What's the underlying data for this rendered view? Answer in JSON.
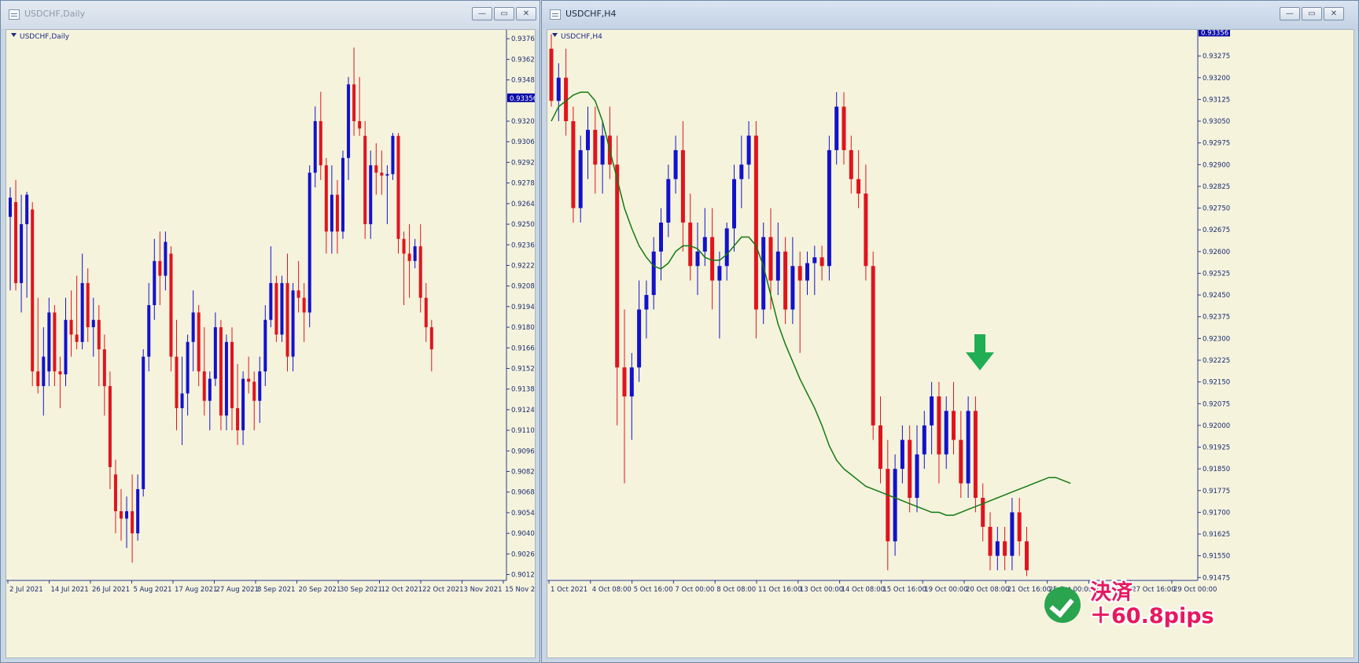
{
  "windows": {
    "left": {
      "title": "USDCHF,Daily",
      "chart_label": "USDCHF,Daily",
      "price_tag": "0.93356",
      "btn_min": "—",
      "btn_max": "▭",
      "btn_close": "✕"
    },
    "right": {
      "title": "USDCHF,H4",
      "chart_label": "USDCHF,H4",
      "price_tag": "0.93356",
      "btn_min": "—",
      "btn_max": "▭",
      "btn_close": "✕"
    }
  },
  "colors": {
    "bull": "#1212cc",
    "bear": "#e0141e",
    "ma": "#137a13",
    "chart_bg": "#f5f3dc",
    "arrow": "#1fae53",
    "badge_text": "#e8185e"
  },
  "annotation": {
    "line1": "決済",
    "line2": "＋60.8pips",
    "icon": "check-circle-icon",
    "arrow_icon": "down-arrow-icon"
  },
  "chart_data": [
    {
      "type": "candlestick",
      "title": "USDCHF,Daily",
      "ylim": [
        0.9008,
        0.9382
      ],
      "y_ticks": [
        "0.93760",
        "0.93620",
        "0.93480",
        "0.93200",
        "0.93060",
        "0.92920",
        "0.92780",
        "0.92640",
        "0.92500",
        "0.92360",
        "0.92220",
        "0.92080",
        "0.91940",
        "0.91800",
        "0.91660",
        "0.91520",
        "0.91380",
        "0.91240",
        "0.91100",
        "0.90960",
        "0.90820",
        "0.90680",
        "0.90540",
        "0.90400",
        "0.90260",
        "0.90120"
      ],
      "x_ticks": [
        "2 Jul 2021",
        "14 Jul 2021",
        "26 Jul 2021",
        "5 Aug 2021",
        "17 Aug 2021",
        "27 Aug 2021",
        "8 Sep 2021",
        "20 Sep 2021",
        "30 Sep 2021",
        "12 Oct 2021",
        "22 Oct 2021",
        "3 Nov 2021",
        "15 Nov 2021"
      ],
      "candles": [
        [
          0.9255,
          0.9275,
          0.9205,
          0.9268
        ],
        [
          0.9265,
          0.928,
          0.9205,
          0.921
        ],
        [
          0.921,
          0.927,
          0.919,
          0.925
        ],
        [
          0.925,
          0.9272,
          0.92,
          0.927
        ],
        [
          0.926,
          0.9265,
          0.914,
          0.915
        ],
        [
          0.915,
          0.92,
          0.9135,
          0.914
        ],
        [
          0.914,
          0.918,
          0.912,
          0.916
        ],
        [
          0.915,
          0.92,
          0.914,
          0.919
        ],
        [
          0.919,
          0.9195,
          0.914,
          0.915
        ],
        [
          0.915,
          0.916,
          0.9125,
          0.9148
        ],
        [
          0.9148,
          0.92,
          0.914,
          0.9185
        ],
        [
          0.9185,
          0.9205,
          0.916,
          0.9175
        ],
        [
          0.9175,
          0.9215,
          0.9165,
          0.917
        ],
        [
          0.917,
          0.923,
          0.9165,
          0.921
        ],
        [
          0.921,
          0.922,
          0.917,
          0.918
        ],
        [
          0.918,
          0.92,
          0.916,
          0.9185
        ],
        [
          0.9185,
          0.9195,
          0.914,
          0.9165
        ],
        [
          0.9165,
          0.9175,
          0.912,
          0.914
        ],
        [
          0.914,
          0.915,
          0.907,
          0.9085
        ],
        [
          0.908,
          0.909,
          0.904,
          0.9055
        ],
        [
          0.9055,
          0.907,
          0.9035,
          0.905
        ],
        [
          0.905,
          0.9065,
          0.903,
          0.9055
        ],
        [
          0.9055,
          0.908,
          0.902,
          0.904
        ],
        [
          0.904,
          0.908,
          0.9035,
          0.907
        ],
        [
          0.907,
          0.9165,
          0.9065,
          0.916
        ],
        [
          0.916,
          0.921,
          0.915,
          0.9195
        ],
        [
          0.9195,
          0.924,
          0.9185,
          0.9225
        ],
        [
          0.9225,
          0.9245,
          0.9195,
          0.9215
        ],
        [
          0.9215,
          0.9245,
          0.9205,
          0.9238
        ],
        [
          0.923,
          0.9235,
          0.915,
          0.916
        ],
        [
          0.916,
          0.9185,
          0.911,
          0.9125
        ],
        [
          0.9125,
          0.916,
          0.91,
          0.9135
        ],
        [
          0.9135,
          0.9175,
          0.912,
          0.917
        ],
        [
          0.917,
          0.9205,
          0.915,
          0.919
        ],
        [
          0.919,
          0.9195,
          0.914,
          0.915
        ],
        [
          0.915,
          0.918,
          0.912,
          0.913
        ],
        [
          0.913,
          0.915,
          0.911,
          0.9145
        ],
        [
          0.9145,
          0.919,
          0.914,
          0.918
        ],
        [
          0.918,
          0.9185,
          0.911,
          0.912
        ],
        [
          0.912,
          0.9175,
          0.911,
          0.917
        ],
        [
          0.917,
          0.918,
          0.911,
          0.9125
        ],
        [
          0.9125,
          0.9155,
          0.91,
          0.911
        ],
        [
          0.911,
          0.915,
          0.91,
          0.9145
        ],
        [
          0.9145,
          0.916,
          0.9135,
          0.9143
        ],
        [
          0.9143,
          0.915,
          0.911,
          0.913
        ],
        [
          0.913,
          0.916,
          0.9115,
          0.915
        ],
        [
          0.915,
          0.9195,
          0.914,
          0.9185
        ],
        [
          0.9185,
          0.9235,
          0.918,
          0.921
        ],
        [
          0.921,
          0.9215,
          0.917,
          0.9175
        ],
        [
          0.9175,
          0.9215,
          0.917,
          0.921
        ],
        [
          0.921,
          0.923,
          0.915,
          0.916
        ],
        [
          0.916,
          0.921,
          0.915,
          0.9205
        ],
        [
          0.9205,
          0.9225,
          0.919,
          0.92
        ],
        [
          0.92,
          0.921,
          0.917,
          0.919
        ],
        [
          0.919,
          0.929,
          0.918,
          0.9285
        ],
        [
          0.9285,
          0.933,
          0.9275,
          0.932
        ],
        [
          0.932,
          0.934,
          0.928,
          0.929
        ],
        [
          0.929,
          0.9295,
          0.923,
          0.9245
        ],
        [
          0.9245,
          0.929,
          0.923,
          0.927
        ],
        [
          0.927,
          0.928,
          0.923,
          0.9245
        ],
        [
          0.9245,
          0.93,
          0.924,
          0.9295
        ],
        [
          0.9295,
          0.935,
          0.928,
          0.9345
        ],
        [
          0.9345,
          0.937,
          0.931,
          0.932
        ],
        [
          0.932,
          0.935,
          0.931,
          0.9315
        ],
        [
          0.931,
          0.932,
          0.924,
          0.925
        ],
        [
          0.925,
          0.93,
          0.924,
          0.929
        ],
        [
          0.929,
          0.9305,
          0.927,
          0.9285
        ],
        [
          0.9285,
          0.93,
          0.927,
          0.9283
        ],
        [
          0.9283,
          0.929,
          0.925,
          0.9284
        ],
        [
          0.9284,
          0.9312,
          0.928,
          0.931
        ],
        [
          0.931,
          0.9312,
          0.923,
          0.924
        ],
        [
          0.924,
          0.9245,
          0.9195,
          0.923
        ],
        [
          0.923,
          0.925,
          0.92,
          0.9225
        ],
        [
          0.9225,
          0.924,
          0.922,
          0.9235
        ],
        [
          0.9235,
          0.925,
          0.919,
          0.92
        ],
        [
          0.92,
          0.921,
          0.917,
          0.918
        ],
        [
          0.918,
          0.9185,
          0.915,
          0.9165
        ]
      ]
    },
    {
      "type": "candlestick",
      "title": "USDCHF,H4",
      "ylim": [
        0.91465,
        0.93365
      ],
      "y_ticks": [
        "0.93275",
        "0.93200",
        "0.93125",
        "0.93050",
        "0.92975",
        "0.92900",
        "0.92825",
        "0.92750",
        "0.92675",
        "0.92600",
        "0.92525",
        "0.92450",
        "0.92375",
        "0.92300",
        "0.92225",
        "0.92150",
        "0.92075",
        "0.92000",
        "0.91925",
        "0.91850",
        "0.91775",
        "0.91700",
        "0.91625",
        "0.91550",
        "0.91475"
      ],
      "x_ticks": [
        "1 Oct 2021",
        "4 Oct 08:00",
        "5 Oct 16:00",
        "7 Oct 00:00",
        "8 Oct 08:00",
        "11 Oct 16:00",
        "13 Oct 00:00",
        "14 Oct 08:00",
        "15 Oct 16:00",
        "19 Oct 00:00",
        "20 Oct 08:00",
        "21 Oct 16:00",
        "25 Oct 00:00",
        "26 Oct 08:00",
        "27 Oct 16:00",
        "29 Oct 00:00"
      ],
      "series": [
        {
          "name": "",
          "type": "moving-average"
        }
      ],
      "ma": [
        0.9305,
        0.931,
        0.9312,
        0.9314,
        0.9315,
        0.9315,
        0.9312,
        0.9305,
        0.9295,
        0.9285,
        0.9275,
        0.9268,
        0.9262,
        0.9258,
        0.9255,
        0.9254,
        0.9256,
        0.926,
        0.9262,
        0.9262,
        0.9261,
        0.9258,
        0.9257,
        0.9257,
        0.9259,
        0.9262,
        0.9265,
        0.9265,
        0.9262,
        0.9255,
        0.9245,
        0.9235,
        0.9228,
        0.9222,
        0.9216,
        0.9211,
        0.9206,
        0.92,
        0.9193,
        0.9188,
        0.9185,
        0.9183,
        0.9181,
        0.9179,
        0.9178,
        0.9177,
        0.9176,
        0.9175,
        0.9174,
        0.9173,
        0.9172,
        0.9171,
        0.917,
        0.917,
        0.9169,
        0.9169,
        0.917,
        0.9171,
        0.9172,
        0.9173,
        0.9174,
        0.9175,
        0.9176,
        0.9177,
        0.9178,
        0.9179,
        0.918,
        0.9181,
        0.9182,
        0.9182,
        0.9181,
        0.918
      ],
      "candles": [
        [
          0.933,
          0.9335,
          0.931,
          0.9312
        ],
        [
          0.9312,
          0.9325,
          0.9305,
          0.932
        ],
        [
          0.932,
          0.933,
          0.93,
          0.9305
        ],
        [
          0.9305,
          0.931,
          0.927,
          0.9275
        ],
        [
          0.9275,
          0.93,
          0.927,
          0.9295
        ],
        [
          0.9295,
          0.931,
          0.9285,
          0.9302
        ],
        [
          0.9302,
          0.931,
          0.928,
          0.929
        ],
        [
          0.929,
          0.9305,
          0.928,
          0.93
        ],
        [
          0.93,
          0.931,
          0.9285,
          0.929
        ],
        [
          0.929,
          0.93,
          0.92,
          0.922
        ],
        [
          0.922,
          0.924,
          0.918,
          0.921
        ],
        [
          0.921,
          0.9225,
          0.9195,
          0.922
        ],
        [
          0.922,
          0.925,
          0.9215,
          0.924
        ],
        [
          0.924,
          0.925,
          0.923,
          0.9245
        ],
        [
          0.9245,
          0.9265,
          0.924,
          0.926
        ],
        [
          0.926,
          0.9275,
          0.925,
          0.927
        ],
        [
          0.927,
          0.929,
          0.9265,
          0.9285
        ],
        [
          0.9285,
          0.93,
          0.928,
          0.9295
        ],
        [
          0.9295,
          0.9305,
          0.926,
          0.927
        ],
        [
          0.927,
          0.928,
          0.925,
          0.9255
        ],
        [
          0.9255,
          0.927,
          0.9245,
          0.926
        ],
        [
          0.926,
          0.9275,
          0.9255,
          0.9265
        ],
        [
          0.9265,
          0.9275,
          0.924,
          0.925
        ],
        [
          0.925,
          0.926,
          0.923,
          0.9255
        ],
        [
          0.9255,
          0.927,
          0.925,
          0.9268
        ],
        [
          0.9268,
          0.929,
          0.926,
          0.9285
        ],
        [
          0.9285,
          0.93,
          0.9275,
          0.929
        ],
        [
          0.929,
          0.9305,
          0.9285,
          0.93
        ],
        [
          0.93,
          0.9305,
          0.923,
          0.924
        ],
        [
          0.924,
          0.927,
          0.9235,
          0.9265
        ],
        [
          0.9265,
          0.9275,
          0.924,
          0.925
        ],
        [
          0.925,
          0.927,
          0.9245,
          0.926
        ],
        [
          0.926,
          0.9265,
          0.9235,
          0.924
        ],
        [
          0.924,
          0.9265,
          0.9235,
          0.9255
        ],
        [
          0.9255,
          0.926,
          0.9225,
          0.925
        ],
        [
          0.925,
          0.926,
          0.9245,
          0.9256
        ],
        [
          0.9256,
          0.9262,
          0.9245,
          0.9258
        ],
        [
          0.9258,
          0.9262,
          0.925,
          0.9255
        ],
        [
          0.9255,
          0.93,
          0.925,
          0.9295
        ],
        [
          0.9295,
          0.9315,
          0.929,
          0.931
        ],
        [
          0.931,
          0.9315,
          0.929,
          0.9295
        ],
        [
          0.9295,
          0.93,
          0.928,
          0.9285
        ],
        [
          0.9285,
          0.9295,
          0.9275,
          0.928
        ],
        [
          0.928,
          0.929,
          0.925,
          0.9255
        ],
        [
          0.9255,
          0.926,
          0.9195,
          0.92
        ],
        [
          0.92,
          0.921,
          0.918,
          0.9185
        ],
        [
          0.9185,
          0.9195,
          0.915,
          0.916
        ],
        [
          0.916,
          0.919,
          0.9155,
          0.9185
        ],
        [
          0.9185,
          0.92,
          0.918,
          0.9195
        ],
        [
          0.9195,
          0.92,
          0.917,
          0.9175
        ],
        [
          0.9175,
          0.92,
          0.917,
          0.919
        ],
        [
          0.919,
          0.9205,
          0.9185,
          0.92
        ],
        [
          0.92,
          0.9215,
          0.919,
          0.921
        ],
        [
          0.921,
          0.9215,
          0.918,
          0.919
        ],
        [
          0.919,
          0.921,
          0.9185,
          0.9205
        ],
        [
          0.9205,
          0.9215,
          0.919,
          0.9195
        ],
        [
          0.9195,
          0.9205,
          0.9175,
          0.918
        ],
        [
          0.918,
          0.921,
          0.9175,
          0.9205
        ],
        [
          0.9205,
          0.921,
          0.917,
          0.9175
        ],
        [
          0.9175,
          0.918,
          0.916,
          0.9165
        ],
        [
          0.9165,
          0.917,
          0.915,
          0.9155
        ],
        [
          0.9155,
          0.9165,
          0.915,
          0.916
        ],
        [
          0.916,
          0.9165,
          0.915,
          0.9155
        ],
        [
          0.9155,
          0.9175,
          0.915,
          0.917
        ],
        [
          0.917,
          0.9175,
          0.9155,
          0.916
        ],
        [
          0.916,
          0.9165,
          0.9148,
          0.915
        ]
      ]
    }
  ]
}
